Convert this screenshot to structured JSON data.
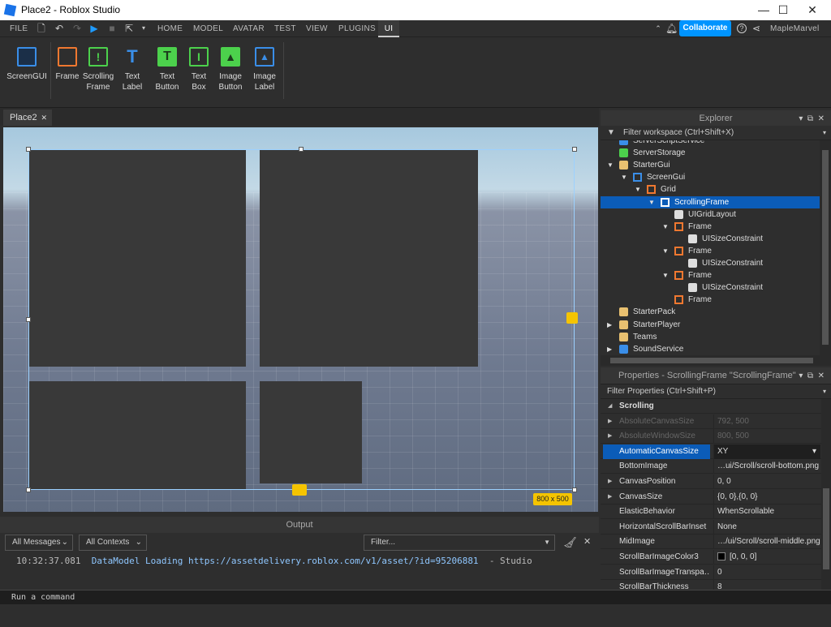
{
  "window": {
    "title": "Place2 - Roblox Studio",
    "minimize": "—",
    "maximize": "☐",
    "close": "✕"
  },
  "menu": {
    "file": "FILE",
    "tabs": [
      "HOME",
      "MODEL",
      "AVATAR",
      "TEST",
      "VIEW",
      "PLUGINS",
      "UI"
    ],
    "active_tab": "UI",
    "collaborate": "Collaborate",
    "username": "MapleMarvel"
  },
  "ribbon": {
    "buttons": [
      {
        "label1": "ScreenGUI",
        "label2": "",
        "icon": "screengui-icon",
        "color": "#3a8ee8"
      },
      {
        "label1": "Frame",
        "label2": "",
        "icon": "frame-icon",
        "color": "#f07830"
      },
      {
        "label1": "Scrolling",
        "label2": "Frame",
        "icon": "scrolling-frame-icon",
        "color": "#4cd14c"
      },
      {
        "label1": "Text",
        "label2": "Label",
        "icon": "text-label-icon",
        "color": "#3a8ee8"
      },
      {
        "label1": "Text",
        "label2": "Button",
        "icon": "text-button-icon",
        "color": "#4cd14c"
      },
      {
        "label1": "Text",
        "label2": "Box",
        "icon": "text-box-icon",
        "color": "#4cd14c"
      },
      {
        "label1": "Image",
        "label2": "Button",
        "icon": "image-button-icon",
        "color": "#4cd14c"
      },
      {
        "label1": "Image",
        "label2": "Label",
        "icon": "image-label-icon",
        "color": "#3a8ee8"
      }
    ]
  },
  "doc_tab": {
    "label": "Place2",
    "close": "✕"
  },
  "viewport": {
    "size_badge": "800 x 500"
  },
  "explorer": {
    "title": "Explorer",
    "filter_placeholder": "Filter workspace (Ctrl+Shift+X)",
    "items": [
      {
        "label": "ServerScriptService",
        "indent": 0,
        "arrow": "",
        "icon": "server-script-service-icon",
        "selected": false
      },
      {
        "label": "ServerStorage",
        "indent": 0,
        "arrow": "",
        "icon": "server-storage-icon",
        "selected": false
      },
      {
        "label": "StarterGui",
        "indent": 0,
        "arrow": "▼",
        "icon": "starter-gui-icon",
        "selected": false
      },
      {
        "label": "ScreenGui",
        "indent": 1,
        "arrow": "▼",
        "icon": "screengui-icon",
        "selected": false
      },
      {
        "label": "Grid",
        "indent": 2,
        "arrow": "▼",
        "icon": "frame-icon",
        "selected": false
      },
      {
        "label": "ScrollingFrame",
        "indent": 3,
        "arrow": "▼",
        "icon": "scrolling-frame-icon",
        "selected": true
      },
      {
        "label": "UIGridLayout",
        "indent": 4,
        "arrow": "",
        "icon": "ui-grid-layout-icon",
        "selected": false
      },
      {
        "label": "Frame",
        "indent": 4,
        "arrow": "▼",
        "icon": "frame-icon",
        "selected": false
      },
      {
        "label": "UISizeConstraint",
        "indent": 5,
        "arrow": "",
        "icon": "ui-size-constraint-icon",
        "selected": false
      },
      {
        "label": "Frame",
        "indent": 4,
        "arrow": "▼",
        "icon": "frame-icon",
        "selected": false
      },
      {
        "label": "UISizeConstraint",
        "indent": 5,
        "arrow": "",
        "icon": "ui-size-constraint-icon",
        "selected": false
      },
      {
        "label": "Frame",
        "indent": 4,
        "arrow": "▼",
        "icon": "frame-icon",
        "selected": false
      },
      {
        "label": "UISizeConstraint",
        "indent": 5,
        "arrow": "",
        "icon": "ui-size-constraint-icon",
        "selected": false
      },
      {
        "label": "Frame",
        "indent": 4,
        "arrow": "",
        "icon": "frame-icon",
        "selected": false
      },
      {
        "label": "StarterPack",
        "indent": 0,
        "arrow": "",
        "icon": "starter-pack-icon",
        "selected": false
      },
      {
        "label": "StarterPlayer",
        "indent": 0,
        "arrow": "▶",
        "icon": "starter-player-icon",
        "selected": false
      },
      {
        "label": "Teams",
        "indent": 0,
        "arrow": "",
        "icon": "teams-icon",
        "selected": false
      },
      {
        "label": "SoundService",
        "indent": 0,
        "arrow": "▶",
        "icon": "sound-service-icon",
        "selected": false
      }
    ]
  },
  "properties": {
    "title": "Properties - ScrollingFrame \"ScrollingFrame\"",
    "filter_placeholder": "Filter Properties (Ctrl+Shift+P)",
    "section": "Scrolling",
    "rows": [
      {
        "name": "AbsoluteCanvasSize",
        "value": "792, 500",
        "disabled": true,
        "arrow": "▶",
        "selected": false,
        "swatch": ""
      },
      {
        "name": "AbsoluteWindowSize",
        "value": "800, 500",
        "disabled": true,
        "arrow": "▶",
        "selected": false,
        "swatch": ""
      },
      {
        "name": "AutomaticCanvasSize",
        "value": "XY",
        "disabled": false,
        "arrow": "",
        "selected": true,
        "swatch": ""
      },
      {
        "name": "BottomImage",
        "value": "…ui/Scroll/scroll-bottom.png",
        "disabled": false,
        "arrow": "",
        "selected": false,
        "swatch": ""
      },
      {
        "name": "CanvasPosition",
        "value": "0, 0",
        "disabled": false,
        "arrow": "▶",
        "selected": false,
        "swatch": ""
      },
      {
        "name": "CanvasSize",
        "value": "{0, 0},{0, 0}",
        "disabled": false,
        "arrow": "▶",
        "selected": false,
        "swatch": ""
      },
      {
        "name": "ElasticBehavior",
        "value": "WhenScrollable",
        "disabled": false,
        "arrow": "",
        "selected": false,
        "swatch": ""
      },
      {
        "name": "HorizontalScrollBarInset",
        "value": "None",
        "disabled": false,
        "arrow": "",
        "selected": false,
        "swatch": ""
      },
      {
        "name": "MidImage",
        "value": "…/ui/Scroll/scroll-middle.png",
        "disabled": false,
        "arrow": "",
        "selected": false,
        "swatch": ""
      },
      {
        "name": "ScrollBarImageColor3",
        "value": "[0, 0, 0]",
        "disabled": false,
        "arrow": "",
        "selected": false,
        "swatch": "#000000"
      },
      {
        "name": "ScrollBarImageTranspa…",
        "value": "0",
        "disabled": false,
        "arrow": "",
        "selected": false,
        "swatch": ""
      },
      {
        "name": "ScrollBarThickness",
        "value": "8",
        "disabled": false,
        "arrow": "",
        "selected": false,
        "swatch": ""
      }
    ]
  },
  "output": {
    "title": "Output",
    "messages_filter": "All Messages",
    "contexts_filter": "All Contexts",
    "filter_placeholder": "Filter...",
    "log": {
      "time": "10:32:37.081",
      "message": "DataModel Loading https://assetdelivery.roblox.com/v1/asset/?id=95206881",
      "source": "-  Studio"
    }
  },
  "command_bar": {
    "placeholder": "Run a command"
  }
}
